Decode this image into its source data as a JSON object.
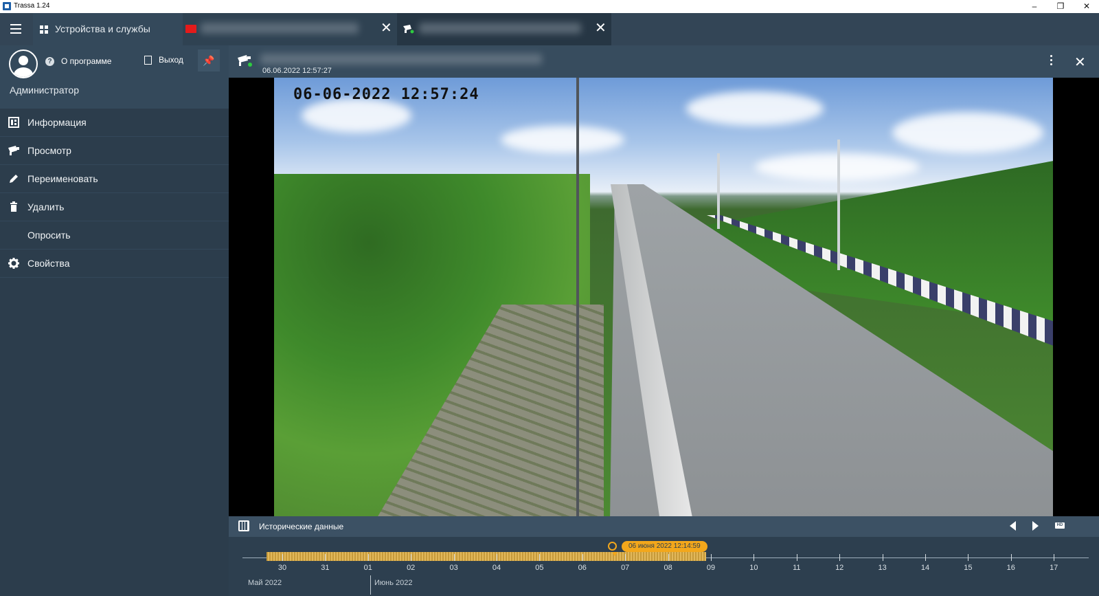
{
  "window": {
    "title": "Trassa 1.24",
    "minimize": "–",
    "restore": "❐",
    "close": "✕"
  },
  "tabs": {
    "devices_label": "Устройства и службы",
    "close_glyph": "✕"
  },
  "sidebar": {
    "about_label": "О программе",
    "logout_label": "Выход",
    "pin_glyph": "📌",
    "user_name": "Администратор",
    "items": [
      {
        "label": "Информация",
        "icon": "info-grid-icon"
      },
      {
        "label": "Просмотр",
        "icon": "camera-icon"
      },
      {
        "label": "Переименовать",
        "icon": "pencil-icon"
      },
      {
        "label": "Удалить",
        "icon": "trash-icon"
      },
      {
        "label": "Опросить",
        "icon": ""
      },
      {
        "label": "Свойства",
        "icon": "gear-icon"
      }
    ]
  },
  "camera": {
    "timestamp": "06.06.2022 12:57:27",
    "osd_text": "06-06-2022 12:57:24"
  },
  "history": {
    "label": "Исторические данные",
    "hd_label": "HD",
    "cursor_label": "06 июня 2022 12:14:59"
  },
  "timeline": {
    "days": [
      "30",
      "31",
      "01",
      "02",
      "03",
      "04",
      "05",
      "06",
      "07",
      "08",
      "09",
      "10",
      "11",
      "12",
      "13",
      "14",
      "15",
      "16",
      "17"
    ],
    "months": [
      "Май 2022",
      "Июнь 2022"
    ],
    "recorded_range": [
      "30",
      "08"
    ]
  },
  "colors": {
    "accent": "#f3a71b",
    "sidebar_bg": "#2c3d4c",
    "recording_fill": "#d9ab4b",
    "folder_icon": "#e51a1a"
  }
}
